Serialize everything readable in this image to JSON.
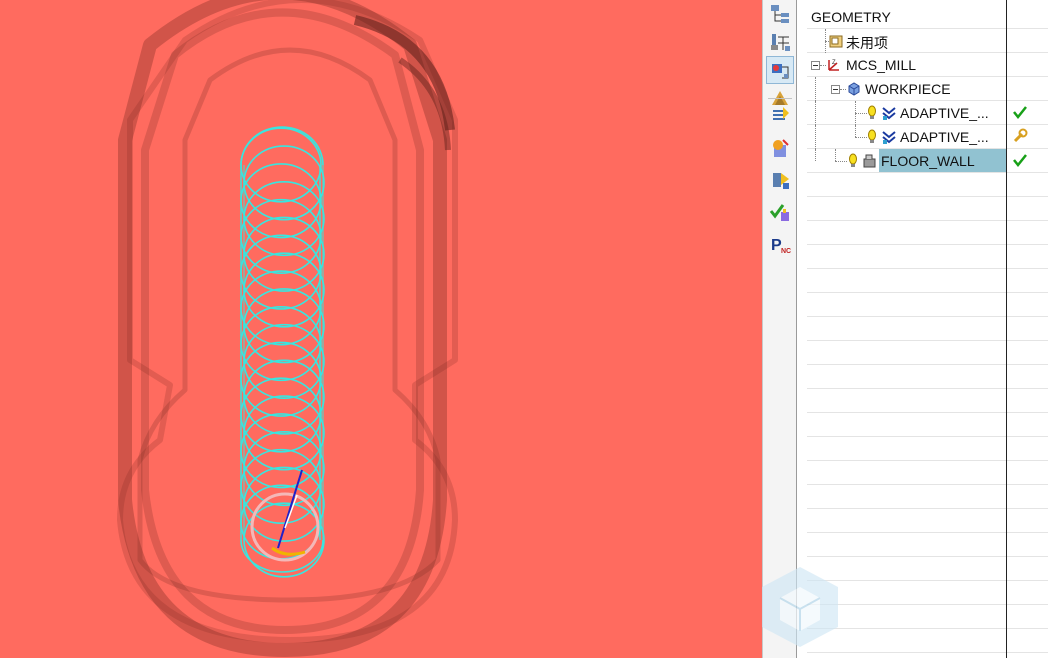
{
  "viewport": {
    "background": "#ff6b5f",
    "toolpath_color": "#38e6e0",
    "tool_outline_color": "#f4b8b8",
    "tool_marker_color": "#f0b400",
    "tool_axis_color": "#2020c8"
  },
  "toolbar": {
    "buttons": [
      {
        "name": "program-order-view-icon"
      },
      {
        "name": "machine-tool-view-icon"
      },
      {
        "name": "geometry-view-icon",
        "active": true
      },
      {
        "name": "machining-method-view-icon"
      },
      {
        "name": "create-program-icon"
      },
      {
        "name": "create-tool-icon"
      },
      {
        "name": "create-geometry-icon"
      },
      {
        "name": "verify-toolpath-icon"
      },
      {
        "name": "postprocess-icon"
      }
    ]
  },
  "navigator": {
    "header": "GEOMETRY",
    "nodes": [
      {
        "label": "未用项",
        "icon": "unused-items-icon",
        "status": ""
      },
      {
        "label": "MCS_MILL",
        "icon": "mcs-icon",
        "status": ""
      },
      {
        "label": "WORKPIECE",
        "icon": "workpiece-icon",
        "status": ""
      },
      {
        "label": "ADAPTIVE_...",
        "icon": "adaptive-milling-op-icon",
        "status": "complete-check"
      },
      {
        "label": "ADAPTIVE_...",
        "icon": "adaptive-milling-op-icon",
        "status": "regenerate-wrench"
      },
      {
        "label": "FLOOR_WALL",
        "icon": "floor-wall-op-icon",
        "status": "complete-check"
      }
    ]
  },
  "watermark": {
    "text": ""
  }
}
